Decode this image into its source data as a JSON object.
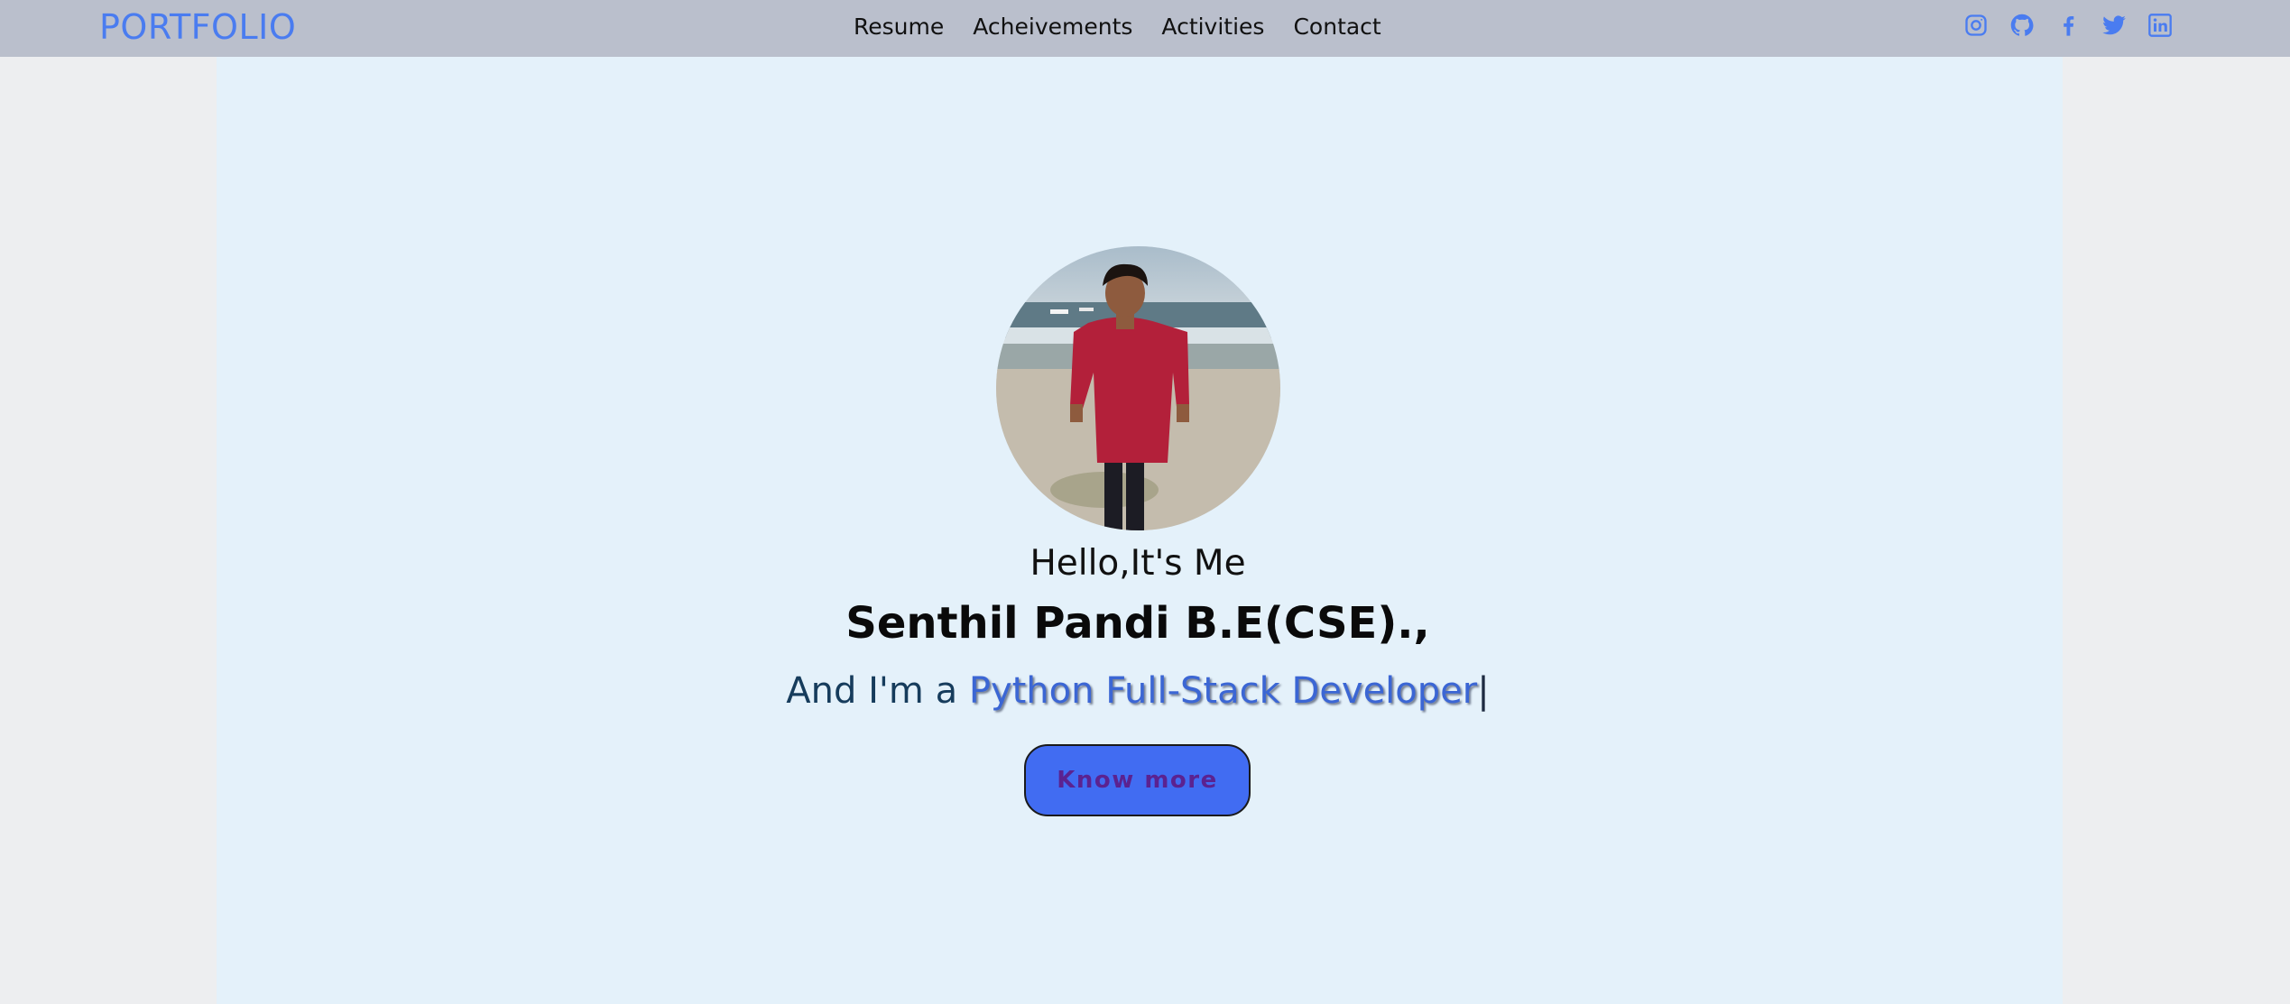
{
  "header": {
    "brand": "PORTFOLIO",
    "nav": [
      "Resume",
      "Acheivements",
      "Activities",
      "Contact"
    ],
    "socials": [
      "instagram-icon",
      "github-icon",
      "facebook-icon",
      "twitter-icon",
      "linkedin-icon"
    ]
  },
  "hero": {
    "greeting": "Hello,It's Me",
    "name": "Senthil Pandi B.E(CSE).,",
    "tagline_prefix": "And I'm a ",
    "role": "Python Full-Stack Developer",
    "cursor": "|",
    "button": "Know more"
  },
  "colors": {
    "accent": "#416cf2",
    "brand": "#4a7cf0",
    "navbar": "#babfcc",
    "hero_bg": "#e4f1fa"
  }
}
